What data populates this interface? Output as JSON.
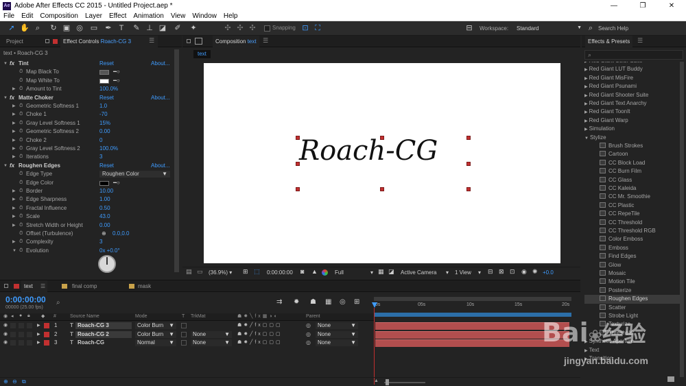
{
  "app": {
    "title": "Adobe After Effects CC 2015 - Untitled Project.aep *",
    "icon": "Ae"
  },
  "window_controls": [
    "—",
    "❐",
    "✕"
  ],
  "menu": [
    "File",
    "Edit",
    "Composition",
    "Layer",
    "Effect",
    "Animation",
    "View",
    "Window",
    "Help"
  ],
  "toolbar": {
    "snapping": "Snapping",
    "workspace_label": "Workspace:",
    "workspace_value": "Standard",
    "search_help": "Search Help"
  },
  "left_panel": {
    "tab_project": "Project",
    "tab_effect_controls": "Effect Controls",
    "tab_effect_layer": "Roach-CG 3",
    "breadcrumb": "text • Roach-CG 3",
    "rows": [
      {
        "kind": "fx",
        "label": "Tint",
        "reset": "Reset",
        "about": "About..."
      },
      {
        "kind": "prop",
        "label": "Map Black To",
        "swatch": "#555555"
      },
      {
        "kind": "prop",
        "label": "Map White To",
        "swatch": "#ffffff"
      },
      {
        "kind": "prop",
        "label": "Amount to Tint",
        "value": "100.0%",
        "tri": true
      },
      {
        "kind": "fx",
        "label": "Matte Choker",
        "reset": "Reset",
        "about": "About..."
      },
      {
        "kind": "prop",
        "label": "Geometric Softness 1",
        "value": "1.0",
        "tri": true
      },
      {
        "kind": "prop",
        "label": "Choke 1",
        "value": "-70",
        "tri": true
      },
      {
        "kind": "prop",
        "label": "Gray Level Softness 1",
        "value": "15%",
        "tri": true
      },
      {
        "kind": "prop",
        "label": "Geometric Softness 2",
        "value": "0.00",
        "tri": true
      },
      {
        "kind": "prop",
        "label": "Choke 2",
        "value": "0",
        "tri": true
      },
      {
        "kind": "prop",
        "label": "Gray Level Softness 2",
        "value": "100.0%",
        "tri": true
      },
      {
        "kind": "prop",
        "label": "Iterations",
        "value": "3",
        "tri": true
      },
      {
        "kind": "fx",
        "label": "Roughen Edges",
        "reset": "Reset",
        "about": "About..."
      },
      {
        "kind": "prop",
        "label": "Edge Type",
        "dropdown": "Roughen Color"
      },
      {
        "kind": "prop",
        "label": "Edge Color",
        "swatch": "#000000"
      },
      {
        "kind": "prop",
        "label": "Border",
        "value": "10.00",
        "tri": true
      },
      {
        "kind": "prop",
        "label": "Edge Sharpness",
        "value": "1.00",
        "tri": true
      },
      {
        "kind": "prop",
        "label": "Fractal Influence",
        "value": "0.50",
        "tri": true
      },
      {
        "kind": "prop",
        "label": "Scale",
        "value": "43.0",
        "tri": true
      },
      {
        "kind": "prop",
        "label": "Stretch Width or Height",
        "value": "0.00",
        "tri": true
      },
      {
        "kind": "prop",
        "label": "Offset (Turbulence)",
        "value": "0.0,0.0",
        "tri": false,
        "crosshair": true
      },
      {
        "kind": "prop",
        "label": "Complexity",
        "value": "3",
        "tri": true
      },
      {
        "kind": "prop",
        "label": "Evolution",
        "value": "0x +0.0°",
        "tri": true,
        "open": true
      }
    ]
  },
  "composition": {
    "tab_label": "Composition",
    "comp_name": "text",
    "comp_chip": "text",
    "canvas_text": "Roach-CG",
    "footer": {
      "zoom": "(36.9%)",
      "timecode": "0:00:00:00",
      "resolution": "Full",
      "camera": "Active Camera",
      "views": "1 View",
      "exposure": "+0.0"
    }
  },
  "effects_presets": {
    "title": "Effects & Presets",
    "search_placeholder": "",
    "items": [
      {
        "label": "Red Giant Color Suite",
        "type": "cat"
      },
      {
        "label": "Red Giant LUT Buddy",
        "type": "cat"
      },
      {
        "label": "Red Giant MisFire",
        "type": "cat"
      },
      {
        "label": "Red Giant Psunami",
        "type": "cat"
      },
      {
        "label": "Red Giant Shooter Suite",
        "type": "cat"
      },
      {
        "label": "Red Giant Text Anarchy",
        "type": "cat"
      },
      {
        "label": "Red Giant ToonIt",
        "type": "cat"
      },
      {
        "label": "Red Giant Warp",
        "type": "cat"
      },
      {
        "label": "Simulation",
        "type": "cat"
      },
      {
        "label": "Stylize",
        "type": "open"
      },
      {
        "label": "Brush Strokes",
        "type": "fx"
      },
      {
        "label": "Cartoon",
        "type": "fx"
      },
      {
        "label": "CC Block Load",
        "type": "fx"
      },
      {
        "label": "CC Burn Film",
        "type": "fx"
      },
      {
        "label": "CC Glass",
        "type": "fx"
      },
      {
        "label": "CC Kaleida",
        "type": "fx"
      },
      {
        "label": "CC Mr. Smoothie",
        "type": "fx"
      },
      {
        "label": "CC Plastic",
        "type": "fx"
      },
      {
        "label": "CC RepeTile",
        "type": "fx"
      },
      {
        "label": "CC Threshold",
        "type": "fx"
      },
      {
        "label": "CC Threshold RGB",
        "type": "fx"
      },
      {
        "label": "Color Emboss",
        "type": "fx"
      },
      {
        "label": "Emboss",
        "type": "fx"
      },
      {
        "label": "Find Edges",
        "type": "fx"
      },
      {
        "label": "Glow",
        "type": "fx"
      },
      {
        "label": "Mosaic",
        "type": "fx"
      },
      {
        "label": "Motion Tile",
        "type": "fx"
      },
      {
        "label": "Posterize",
        "type": "fx"
      },
      {
        "label": "Roughen Edges",
        "type": "fx",
        "selected": true
      },
      {
        "label": "Scatter",
        "type": "fx"
      },
      {
        "label": "Strobe Light",
        "type": "fx"
      },
      {
        "label": "Texturize",
        "type": "fx"
      },
      {
        "label": "Threshold",
        "type": "fx"
      },
      {
        "label": "Synthetic Aperture",
        "type": "cat"
      },
      {
        "label": "Text",
        "type": "cat"
      },
      {
        "label": "Transition",
        "type": "cat"
      }
    ]
  },
  "timeline": {
    "tabs": [
      "text",
      "final comp",
      "mask"
    ],
    "timecode": "0:00:00:00",
    "fps": "00000 (25.00 fps)",
    "headers": {
      "num": "#",
      "source": "Source Name",
      "mode": "Mode",
      "t": "T",
      "trkmat": "TrkMat",
      "parent": "Parent"
    },
    "ruler": [
      "0s",
      "05s",
      "10s",
      "15s",
      "20s"
    ],
    "layers": [
      {
        "num": "1",
        "name": "Roach-CG 3",
        "mode": "Color Burn",
        "trkmat": "",
        "parent": "None",
        "boxed": true
      },
      {
        "num": "2",
        "name": "Roach-CG 2",
        "mode": "Color Burn",
        "trkmat": "None",
        "parent": "None",
        "boxed": true
      },
      {
        "num": "3",
        "name": "Roach-CG",
        "mode": "Normal",
        "trkmat": "None",
        "parent": "None",
        "boxed": false
      }
    ]
  },
  "watermark": {
    "brand": "Bai",
    "brand2": "经验",
    "url": "jingyan.baidu.com"
  },
  "colors": {
    "accent": "#3f9cff",
    "layer_label": "#b24e4e",
    "handle": "#c23030"
  }
}
